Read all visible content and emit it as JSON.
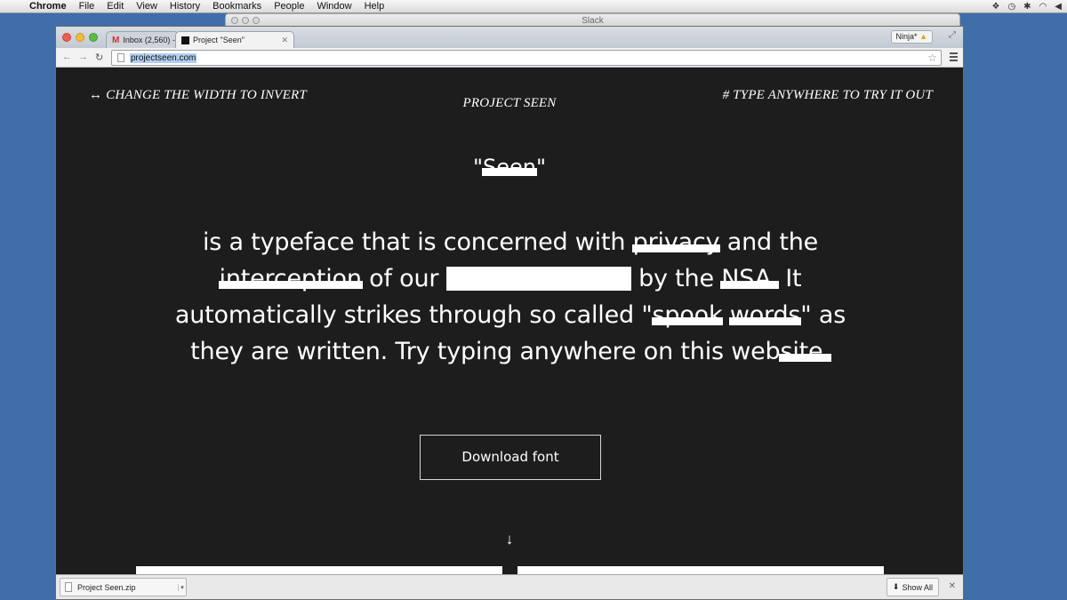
{
  "menubar": {
    "apple_icon": "apple-icon",
    "items": [
      "Chrome",
      "File",
      "Edit",
      "View",
      "History",
      "Bookmarks",
      "People",
      "Window",
      "Help"
    ]
  },
  "slack_window": {
    "title": "Slack"
  },
  "browser": {
    "tabs": [
      {
        "label": "Inbox (2,560) -",
        "icon": "gmail-icon",
        "active": false
      },
      {
        "label": "Project \"Seen\"",
        "icon": "page-favicon",
        "active": true
      }
    ],
    "profile_label": "Ninja*",
    "address": "projectseen.com"
  },
  "page": {
    "nav_left": "↔ CHANGE THE WIDTH TO INVERT",
    "nav_center": "PROJECT SEEN",
    "nav_right": "# TYPE ANYWHERE TO TRY IT OUT",
    "title_open_quote": "\"",
    "title_word": "Seen",
    "title_close_quote": "\"",
    "text": {
      "p1": "is a typeface that is concerned with ",
      "w_privacy": "privacy",
      "p2": " and the",
      "w_interception": "interception",
      "p3": " of our ",
      "p4": " by the ",
      "w_nsa": "NSA.",
      "p5": " It",
      "p6": "automatically strikes through so called \"",
      "w_spook": "spook",
      "w_words": "words",
      "p7": "\" as",
      "p8": "they are written. Try typing anywhere on this web",
      "w_site": "site."
    },
    "download_button": "Download font",
    "scroll_arrow": "↓"
  },
  "download_shelf": {
    "file_name": "Project Seen.zip",
    "show_all": "Show All"
  },
  "colors": {
    "page_background": "#1d1d1d",
    "desktop": "#3f6ea8",
    "text": "#ffffff"
  }
}
